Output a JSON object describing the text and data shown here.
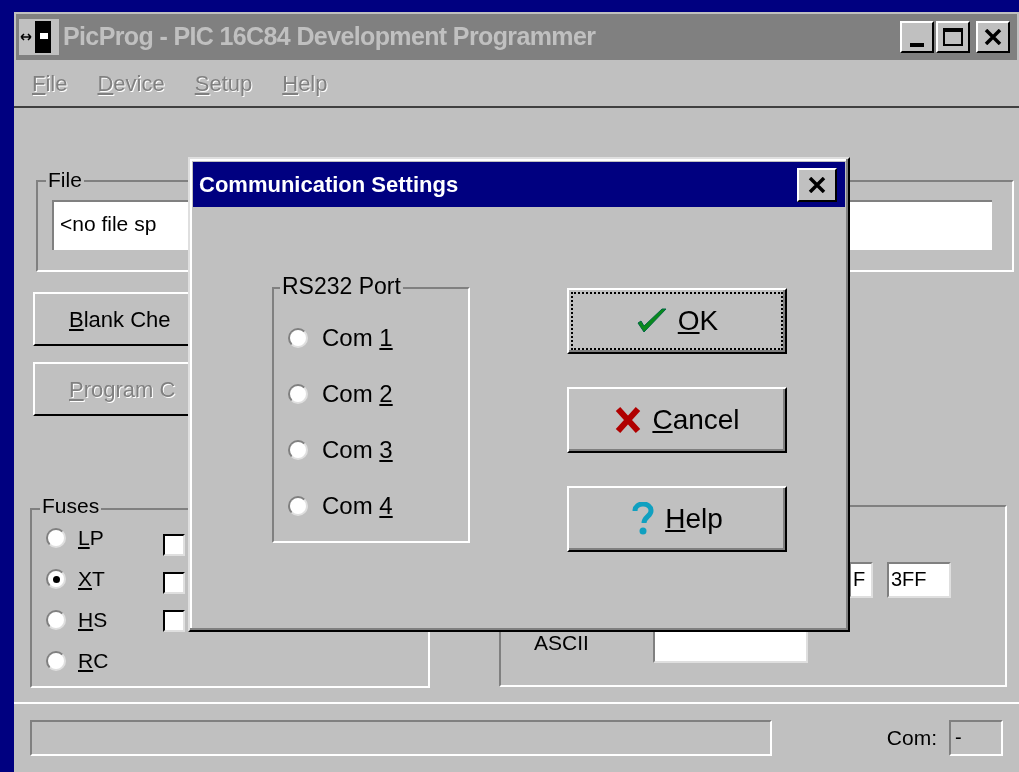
{
  "main_window": {
    "title": "PicProg - PIC 16C84 Development Programmer"
  },
  "menu": [
    {
      "label": "File",
      "disabled": true
    },
    {
      "label": "Device",
      "disabled": true
    },
    {
      "label": "Setup",
      "disabled": true
    },
    {
      "label": "Help",
      "disabled": true
    }
  ],
  "file_group": {
    "label": "File",
    "value": "<no file sp"
  },
  "buttons": [
    {
      "label": "Blank Che",
      "disabled": false
    },
    {
      "label": "Program C",
      "disabled": true
    }
  ],
  "fuses": {
    "label": "Fuses",
    "oscillator": [
      {
        "label": "LP",
        "selected": false
      },
      {
        "label": "XT",
        "selected": true
      },
      {
        "label": "HS",
        "selected": false
      },
      {
        "label": "RC",
        "selected": false
      }
    ],
    "checkboxes": [
      {
        "checked": false
      },
      {
        "checked": false
      },
      {
        "checked": false
      }
    ]
  },
  "right_group": {
    "fields": [
      "F",
      "3FF"
    ],
    "ascii_label": "ASCII"
  },
  "dialog": {
    "title": "Communication Settings",
    "port_group": {
      "label": "RS232 Port",
      "options": [
        {
          "label": "Com 1",
          "selected": false
        },
        {
          "label": "Com 2",
          "selected": false
        },
        {
          "label": "Com 3",
          "selected": false
        },
        {
          "label": "Com 4",
          "selected": false
        }
      ]
    },
    "buttons": [
      {
        "kind": "ok",
        "label": "OK",
        "focused": true
      },
      {
        "kind": "cancel",
        "label": "Cancel",
        "focused": false
      },
      {
        "kind": "help",
        "label": "Help",
        "focused": false
      }
    ]
  },
  "status_bar": {
    "com_label": "Com:",
    "com_value": "-"
  }
}
